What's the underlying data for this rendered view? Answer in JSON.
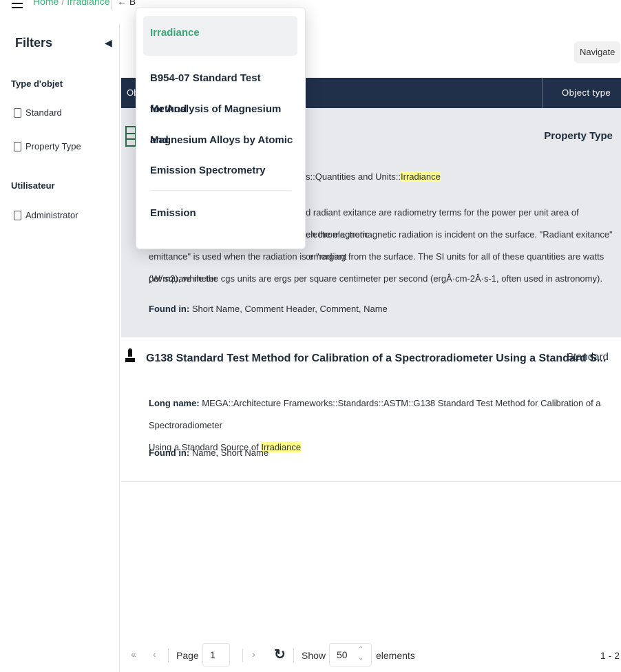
{
  "breadcrumb": {
    "home": "Home",
    "current": "Irradiance",
    "back_label": "B"
  },
  "sidebar": {
    "title": "Filters",
    "groups": [
      {
        "title": "Type d'objet",
        "items": [
          "Standard",
          "Property Type"
        ]
      },
      {
        "title": "Utilisateur",
        "items": [
          "Administrator"
        ]
      }
    ]
  },
  "toolbar": {
    "navigate_label": "Navigate"
  },
  "table": {
    "col1": "Ob",
    "col2": "Object type"
  },
  "results": [
    {
      "type": "Property Type",
      "long_name_prefix": "s::Quantities and Units::",
      "long_name_hl": "Irradiance",
      "desc_line1": "d radiant exitance are radiometry terms for the power per unit area of electromagnetic",
      "desc_line2": "en the electromagnetic radiation is incident on the surface. \"Radiant exitance\" or \"radiant",
      "desc_line3": "emittance\" is used when the radiation is emerging from the surface. The SI units for all of these quantities are watts per square meter",
      "desc_line4": "(W/m2), while the cgs units are ergs per square centimeter per second (ergÂ·cm-2Â·s-1, often used in astronomy).",
      "found_label": "Found in:",
      "found": "Short Name, Comment Header, Comment, Name"
    },
    {
      "title": "G138 Standard Test Method for Calibration of a Spectroradiometer Using a Standard S...",
      "type": "Standard",
      "long_name_label": "Long name:",
      "long_name_line1": "MEGA::Architecture Frameworks::Standards::ASTM::G138 Standard Test Method for Calibration of a Spectroradiometer",
      "long_name_line2_prefix": "Using a Standard Source of ",
      "long_name_hl": "Irradiance",
      "found_label": "Found in:",
      "found": "Name, Short Name"
    }
  ],
  "dropdown": {
    "items": [
      "Irradiance",
      "B954-07 Standard Test Method",
      "for Analysis of Magnesium and",
      "Magnesium Alloys by Atomic",
      "Emission Spectrometry",
      "Emission"
    ]
  },
  "pager": {
    "page_label": "Page",
    "page_value": "1",
    "show_label": "Show",
    "show_value": "50",
    "elements_label": "elements",
    "range": "1 - 2"
  }
}
